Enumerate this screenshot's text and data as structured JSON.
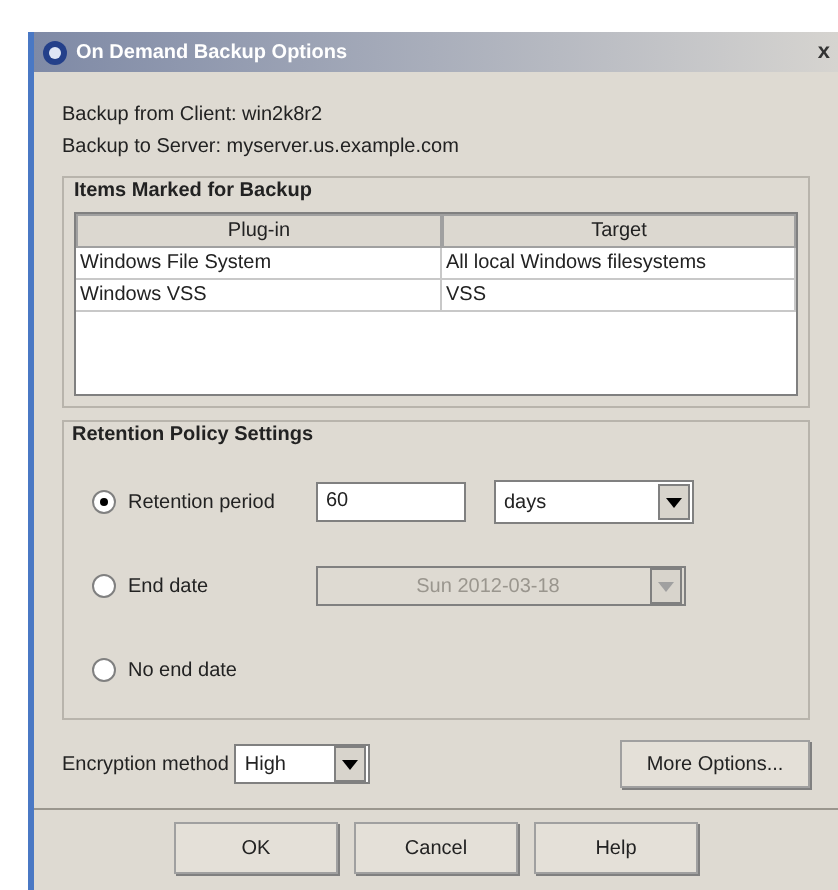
{
  "window": {
    "title": "On Demand Backup Options",
    "close": "x"
  },
  "info": [
    "Backup from Client: win2k8r2",
    "Backup to Server: myserver.us.example.com"
  ],
  "items_group": {
    "title": "Items Marked for Backup",
    "columns": [
      "Plug-in",
      "Target"
    ],
    "rows": [
      {
        "cells": [
          "Windows File System",
          "All local Windows filesystems"
        ]
      },
      {
        "cells": [
          "Windows VSS",
          "VSS"
        ]
      }
    ]
  },
  "retention": {
    "title": "Retention Policy Settings",
    "options": [
      {
        "kind": "period",
        "label": "Retention period",
        "selected": true,
        "value": "60",
        "unit": "days",
        "disabled": false
      },
      {
        "kind": "date",
        "label": "End date",
        "selected": false,
        "value": "Sun 2012-03-18",
        "disabled": true
      },
      {
        "kind": "none",
        "label": "No end date",
        "selected": false
      }
    ]
  },
  "encryption": {
    "label": "Encryption method",
    "value": "High"
  },
  "more_button": "More Options...",
  "buttons": [
    "OK",
    "Cancel",
    "Help"
  ]
}
